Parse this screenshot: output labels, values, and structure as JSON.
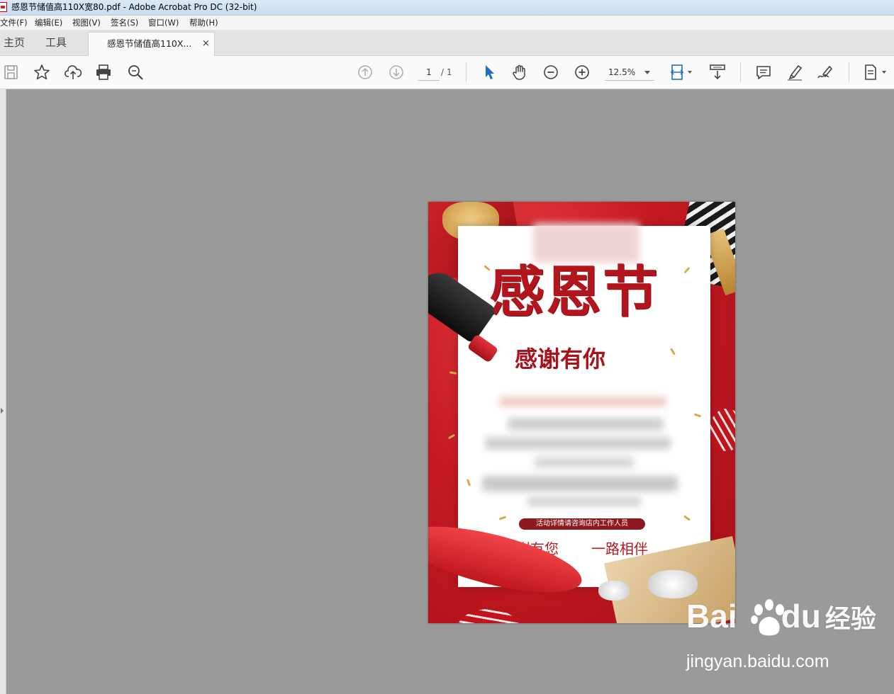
{
  "window": {
    "title": "感恩节储值高110X宽80.pdf - Adobe Acrobat Pro DC (32-bit)"
  },
  "menu": {
    "items": [
      {
        "label": "文件(F)"
      },
      {
        "label": "编辑(E)"
      },
      {
        "label": "视图(V)"
      },
      {
        "label": "签名(S)"
      },
      {
        "label": "窗口(W)"
      },
      {
        "label": "帮助(H)"
      }
    ]
  },
  "tabs": {
    "home": "主页",
    "tools": "工具",
    "document": "感恩节储值高110X...",
    "close_glyph": "×"
  },
  "toolbar": {
    "page_current": "1",
    "page_total": "/ 1",
    "zoom": "12.5%",
    "accent_color": "#1f6fc6"
  },
  "poster": {
    "headline": "感恩节",
    "subhead": "感谢有你",
    "info_pill": "活动详情请咨询店内工作人员",
    "slogan_left": "感谢有您",
    "slogan_right": "一路相伴",
    "primary_color": "#c41c25",
    "gold_color": "#d7a94a"
  },
  "watermark": {
    "logo_left": "Bai",
    "logo_right": "du",
    "logo_cn": "经验",
    "url": "jingyan.baidu.com"
  }
}
